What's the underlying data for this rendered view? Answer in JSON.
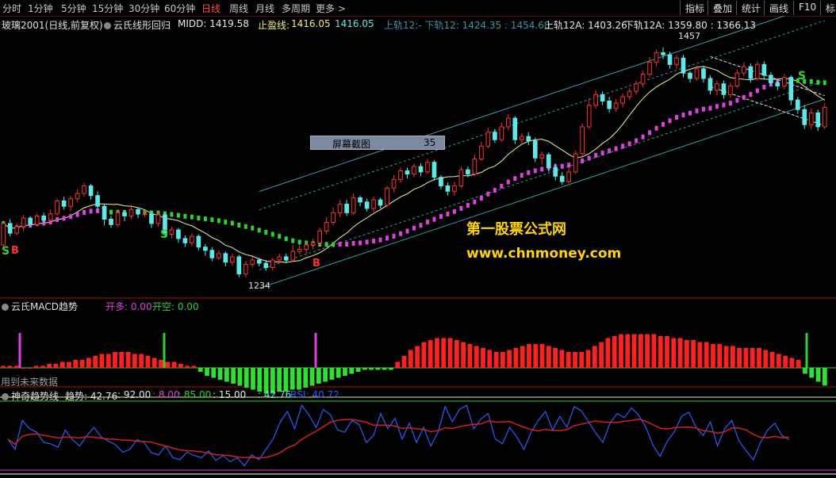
{
  "toolbar": {
    "periods": [
      "分时",
      "1分钟",
      "5分钟",
      "15分钟",
      "30分钟",
      "60分钟",
      "日线",
      "周线",
      "月线",
      "多周期",
      "更多 >"
    ],
    "active_period": "日线",
    "tools": [
      "指标",
      "叠加",
      "统计",
      "画线",
      "F10",
      "标"
    ]
  },
  "main": {
    "instrument": "玻璃2001(日线,前复权)",
    "indicator_name": "云氏线形回归",
    "midd": "MIDD: 1419.58",
    "stop_label": "止盈线:",
    "stop_v1": "1416.05",
    "stop_v2": "1416.05",
    "track12": "上轨12:- 下轨12: 1424.35 : 1454.68",
    "up12a": "上轨12A: 1403.26",
    "down12a": "下轨12A: 1359.80 : 1366.13",
    "high_mark": "1457",
    "low_mark": "1234",
    "s_marks": [
      "S",
      "S",
      "S"
    ],
    "b_marks": [
      "B",
      "B"
    ],
    "screenshot_label": "屏幕截图",
    "screenshot_value": "35",
    "watermark_cn": "第一股票公式网",
    "watermark_url": "www.chnmoney.com"
  },
  "macd": {
    "name": "云氏MACD趋势",
    "long_label": "开多: 0.00",
    "short_label": "开空: 0.00",
    "future_note": "用到未来数据"
  },
  "trend": {
    "name": "神奇趋势线",
    "trend_label": "趋势: 42.76",
    "v1": ": 92.00",
    "v2": ": 8.00",
    "v3": ": 85.00",
    "v4": ": 15.00",
    "v5": ": 42.76",
    "rsi": "RSI: 40.72"
  },
  "colors": {
    "up": "#ff3030",
    "down": "#5ee8e8",
    "ma_yellow": "#f0f0a0",
    "dots_magenta": "#e040e0",
    "dots_green": "#30d030",
    "channel": "#3f95a5",
    "rsi_blue": "#2a5cff",
    "bg": "#000000"
  },
  "chart_data": {
    "type": "candlestick",
    "title": "玻璃2001(日线,前复权)",
    "ylim": [
      1225,
      1470
    ],
    "candles": [
      [
        1270,
        1290,
        1266,
        1291
      ],
      [
        1290,
        1281,
        1278,
        1294
      ],
      [
        1281,
        1287,
        1279,
        1290
      ],
      [
        1287,
        1295,
        1283,
        1298
      ],
      [
        1295,
        1289,
        1287,
        1297
      ],
      [
        1289,
        1297,
        1288,
        1299
      ],
      [
        1297,
        1293,
        1290,
        1300
      ],
      [
        1293,
        1299,
        1291,
        1303
      ],
      [
        1299,
        1311,
        1297,
        1313
      ],
      [
        1311,
        1306,
        1303,
        1315
      ],
      [
        1306,
        1313,
        1302,
        1316
      ],
      [
        1313,
        1318,
        1310,
        1322
      ],
      [
        1318,
        1325,
        1315,
        1328
      ],
      [
        1325,
        1316,
        1312,
        1327
      ],
      [
        1316,
        1306,
        1303,
        1320
      ],
      [
        1306,
        1294,
        1288,
        1308
      ],
      [
        1294,
        1289,
        1286,
        1297
      ],
      [
        1289,
        1300,
        1287,
        1303
      ],
      [
        1300,
        1297,
        1292,
        1302
      ],
      [
        1297,
        1303,
        1294,
        1307
      ],
      [
        1303,
        1299,
        1295,
        1305
      ],
      [
        1299,
        1299,
        1296,
        1302
      ],
      [
        1299,
        1290,
        1286,
        1301
      ],
      [
        1290,
        1298,
        1287,
        1301
      ],
      [
        1298,
        1280,
        1277,
        1300
      ],
      [
        1280,
        1284,
        1276,
        1287
      ],
      [
        1284,
        1276,
        1272,
        1286
      ],
      [
        1276,
        1272,
        1268,
        1279
      ],
      [
        1272,
        1278,
        1269,
        1281
      ],
      [
        1278,
        1268,
        1265,
        1280
      ],
      [
        1268,
        1265,
        1260,
        1271
      ],
      [
        1265,
        1258,
        1255,
        1268
      ],
      [
        1258,
        1262,
        1256,
        1265
      ],
      [
        1262,
        1254,
        1250,
        1264
      ],
      [
        1254,
        1259,
        1251,
        1262
      ],
      [
        1259,
        1243,
        1240,
        1261
      ],
      [
        1243,
        1252,
        1240,
        1255
      ],
      [
        1252,
        1256,
        1249,
        1259
      ],
      [
        1256,
        1253,
        1250,
        1258
      ],
      [
        1253,
        1249,
        1246,
        1256
      ],
      [
        1249,
        1256,
        1246,
        1258
      ],
      [
        1256,
        1259,
        1253,
        1262
      ],
      [
        1259,
        1256,
        1253,
        1262
      ],
      [
        1256,
        1264,
        1254,
        1270
      ],
      [
        1264,
        1266,
        1261,
        1270
      ],
      [
        1266,
        1270,
        1262,
        1273
      ],
      [
        1270,
        1272,
        1266,
        1276
      ],
      [
        1272,
        1283,
        1270,
        1286
      ],
      [
        1283,
        1291,
        1280,
        1296
      ],
      [
        1291,
        1300,
        1288,
        1305
      ],
      [
        1300,
        1308,
        1296,
        1312
      ],
      [
        1308,
        1300,
        1297,
        1312
      ],
      [
        1300,
        1314,
        1298,
        1318
      ],
      [
        1314,
        1310,
        1306,
        1316
      ],
      [
        1310,
        1304,
        1301,
        1313
      ],
      [
        1304,
        1312,
        1301,
        1315
      ],
      [
        1312,
        1307,
        1304,
        1314
      ],
      [
        1307,
        1323,
        1305,
        1325
      ],
      [
        1323,
        1331,
        1319,
        1335
      ],
      [
        1331,
        1339,
        1328,
        1342
      ],
      [
        1339,
        1336,
        1332,
        1342
      ],
      [
        1336,
        1343,
        1333,
        1346
      ],
      [
        1343,
        1338,
        1334,
        1346
      ],
      [
        1338,
        1347,
        1336,
        1350
      ],
      [
        1347,
        1333,
        1330,
        1349
      ],
      [
        1333,
        1325,
        1322,
        1335
      ],
      [
        1325,
        1320,
        1316,
        1328
      ],
      [
        1320,
        1325,
        1316,
        1329
      ],
      [
        1325,
        1340,
        1323,
        1343
      ],
      [
        1340,
        1336,
        1333,
        1343
      ],
      [
        1336,
        1350,
        1334,
        1354
      ],
      [
        1350,
        1362,
        1348,
        1366
      ],
      [
        1362,
        1375,
        1360,
        1379
      ],
      [
        1375,
        1368,
        1365,
        1378
      ],
      [
        1368,
        1380,
        1366,
        1384
      ],
      [
        1380,
        1388,
        1377,
        1392
      ],
      [
        1388,
        1368,
        1364,
        1390
      ],
      [
        1368,
        1371,
        1365,
        1374
      ],
      [
        1371,
        1367,
        1363,
        1375
      ],
      [
        1367,
        1351,
        1347,
        1370
      ],
      [
        1351,
        1354,
        1345,
        1357
      ],
      [
        1354,
        1342,
        1338,
        1356
      ],
      [
        1342,
        1334,
        1330,
        1346
      ],
      [
        1334,
        1329,
        1326,
        1338
      ],
      [
        1329,
        1338,
        1327,
        1342
      ],
      [
        1338,
        1355,
        1336,
        1358
      ],
      [
        1355,
        1380,
        1353,
        1383
      ],
      [
        1380,
        1400,
        1378,
        1405
      ],
      [
        1400,
        1410,
        1397,
        1414
      ],
      [
        1410,
        1404,
        1400,
        1413
      ],
      [
        1404,
        1397,
        1393,
        1408
      ],
      [
        1397,
        1402,
        1394,
        1406
      ],
      [
        1402,
        1408,
        1398,
        1411
      ],
      [
        1408,
        1413,
        1405,
        1416
      ],
      [
        1413,
        1420,
        1410,
        1423
      ],
      [
        1420,
        1429,
        1417,
        1432
      ],
      [
        1429,
        1440,
        1426,
        1445
      ],
      [
        1440,
        1449,
        1436,
        1452
      ],
      [
        1449,
        1447,
        1443,
        1454
      ],
      [
        1447,
        1438,
        1434,
        1450
      ],
      [
        1438,
        1444,
        1434,
        1447
      ],
      [
        1444,
        1430,
        1426,
        1447
      ],
      [
        1430,
        1425,
        1421,
        1432
      ],
      [
        1425,
        1434,
        1423,
        1437
      ],
      [
        1434,
        1425,
        1421,
        1437
      ],
      [
        1425,
        1414,
        1410,
        1428
      ],
      [
        1414,
        1420,
        1409,
        1423
      ],
      [
        1420,
        1410,
        1406,
        1423
      ],
      [
        1410,
        1418,
        1407,
        1421
      ],
      [
        1418,
        1430,
        1416,
        1433
      ],
      [
        1430,
        1436,
        1427,
        1440
      ],
      [
        1436,
        1425,
        1421,
        1439
      ],
      [
        1425,
        1438,
        1423,
        1441
      ],
      [
        1438,
        1428,
        1424,
        1441
      ],
      [
        1428,
        1421,
        1418,
        1431
      ],
      [
        1421,
        1418,
        1414,
        1424
      ],
      [
        1418,
        1426,
        1415,
        1429
      ],
      [
        1426,
        1405,
        1400,
        1428
      ],
      [
        1405,
        1396,
        1392,
        1408
      ],
      [
        1396,
        1382,
        1378,
        1400
      ],
      [
        1382,
        1393,
        1378,
        1397
      ],
      [
        1393,
        1380,
        1376,
        1396
      ],
      [
        1380,
        1398,
        1378,
        1402
      ]
    ],
    "macd_bars": [
      1,
      1,
      1,
      0,
      0,
      1,
      1,
      2,
      2,
      3,
      3,
      4,
      4,
      5,
      6,
      7,
      7,
      8,
      8,
      8,
      7,
      7,
      6,
      5,
      4,
      3,
      3,
      2,
      1,
      1,
      -2,
      -4,
      -5,
      -6,
      -7,
      -8,
      -9,
      -10,
      -11,
      -12,
      -13,
      -13,
      -12,
      -12,
      -11,
      -11,
      -10,
      -9,
      -8,
      -7,
      -6,
      -5,
      -4,
      -3,
      -2,
      -1,
      -1,
      -1,
      -1,
      -1,
      3,
      6,
      9,
      11,
      13,
      14,
      15,
      15,
      15,
      14,
      13,
      12,
      11,
      10,
      9,
      8,
      8,
      9,
      10,
      11,
      12,
      12,
      12,
      11,
      10,
      9,
      8,
      8,
      8,
      9,
      11,
      13,
      15,
      16,
      17,
      17,
      17,
      17,
      17,
      17,
      16,
      16,
      15,
      15,
      14,
      14,
      13,
      13,
      12,
      12,
      11,
      11,
      10,
      10,
      10,
      10,
      9,
      8,
      7,
      6,
      5,
      4,
      -3,
      -5,
      -7,
      -9
    ],
    "rsi": [
      45,
      30,
      72,
      60,
      55,
      40,
      38,
      33,
      58,
      44,
      35,
      50,
      62,
      48,
      42,
      37,
      26,
      30,
      44,
      40,
      25,
      22,
      35,
      18,
      15,
      26,
      21,
      18,
      28,
      14,
      21,
      12,
      18,
      6,
      22,
      15,
      30,
      45,
      70,
      85,
      60,
      94,
      80,
      62,
      88,
      80,
      58,
      55,
      72,
      66,
      40,
      50,
      82,
      60,
      75,
      45,
      68,
      40,
      62,
      35,
      55,
      92,
      70,
      88,
      94,
      60,
      74,
      82,
      45,
      38,
      62,
      48,
      30,
      55,
      72,
      85,
      58,
      78,
      62,
      92,
      86,
      70,
      54,
      40,
      68,
      82,
      76,
      90,
      80,
      62,
      36,
      20,
      42,
      56,
      78,
      84,
      62,
      50,
      70,
      35,
      60,
      72,
      42,
      28,
      15,
      40,
      58,
      68,
      50,
      44
    ]
  }
}
